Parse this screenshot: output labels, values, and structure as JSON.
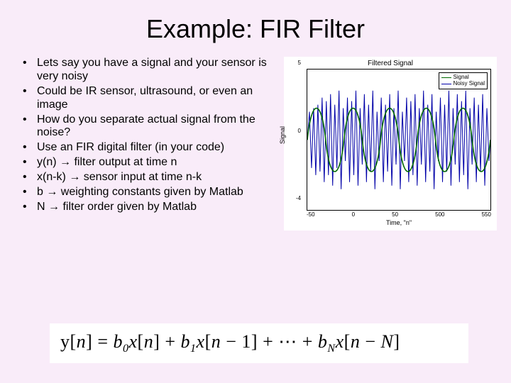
{
  "title": "Example: FIR Filter",
  "bullets": [
    "Lets say you have a signal and your sensor is very noisy",
    "Could be IR sensor, ultrasound, or even an image",
    "How do you separate actual signal from the noise?",
    "Use an FIR digital filter (in your code)",
    "y(n) → filter output at time n",
    "x(n-k) → sensor input at time n-k",
    "b → weighting constants given by Matlab",
    "N → filter order given by Matlab"
  ],
  "formula": "y[n] = b₀x[n] + b₁x[n − 1] + ⋯ + b_N x[n − N]",
  "chart_data": {
    "type": "line",
    "title": "Filtered Signal",
    "xlabel": "Time, \"n\"",
    "ylabel": "Signal",
    "xlim": [
      -50,
      550
    ],
    "ylim": [
      -4,
      5
    ],
    "xticks": [
      -50,
      0,
      50,
      500,
      550
    ],
    "yticks": [
      -4,
      0,
      5
    ],
    "legend_position": "upper-right",
    "series": [
      {
        "name": "Signal",
        "color": "#006900",
        "style": "smooth-oscillation",
        "approx_amplitude": 3.0,
        "approx_cycles": 10
      },
      {
        "name": "Noisy Signal",
        "color": "#0000a8",
        "style": "jagged-oscillation",
        "approx_amplitude": 3.8,
        "approx_cycles": 10
      }
    ]
  },
  "legend": {
    "signal": "Signal",
    "noisy": "Noisy Signal"
  },
  "colors": {
    "signal": "#006900",
    "noisy": "#0000a8"
  }
}
